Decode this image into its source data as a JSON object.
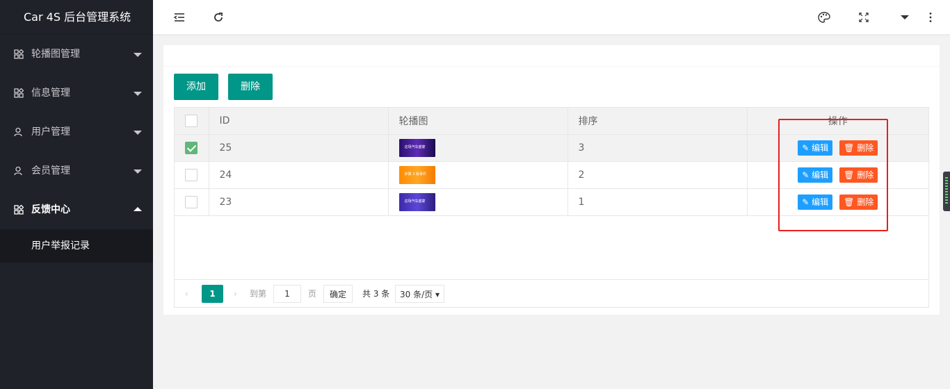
{
  "app": {
    "title": "Car 4S 后台管理系统"
  },
  "sidebar": {
    "items": [
      {
        "label": "轮播图管理",
        "icon": "grid-icon",
        "expanded": false
      },
      {
        "label": "信息管理",
        "icon": "grid-icon",
        "expanded": false
      },
      {
        "label": "用户管理",
        "icon": "user-icon",
        "expanded": false
      },
      {
        "label": "会员管理",
        "icon": "user-icon",
        "expanded": false
      },
      {
        "label": "反馈中心",
        "icon": "grid-icon",
        "expanded": true
      }
    ],
    "submenu": [
      {
        "label": "用户举报记录"
      }
    ]
  },
  "header": {
    "icons": [
      "menu-fold-icon",
      "refresh-icon",
      "theme-palette-icon",
      "fullscreen-icon",
      "user-dropdown-icon",
      "more-icon"
    ]
  },
  "toolbar": {
    "add_label": "添加",
    "delete_label": "删除"
  },
  "table": {
    "columns": [
      "ID",
      "轮播图",
      "排序",
      "操作"
    ],
    "rows": [
      {
        "id": "25",
        "image_text": "这场汽车盛宴",
        "sort": "3",
        "checked": true
      },
      {
        "id": "24",
        "image_text": "步骤 3 级事件",
        "sort": "2",
        "checked": false
      },
      {
        "id": "23",
        "image_text": "这场汽车盛宴",
        "sort": "1",
        "checked": false
      }
    ],
    "edit_label": "编辑",
    "delete_label": "删除"
  },
  "pager": {
    "current_page": "1",
    "goto_label": "到第",
    "page_input": "1",
    "page_suffix": "页",
    "confirm_label": "确定",
    "total_label": "共 3 条",
    "page_size": "30 条/页"
  },
  "colors": {
    "primary": "#009688",
    "edit": "#1E9FFF",
    "delete": "#FF5722",
    "sidebar": "#20222a",
    "annotation": "#e81e1e"
  }
}
